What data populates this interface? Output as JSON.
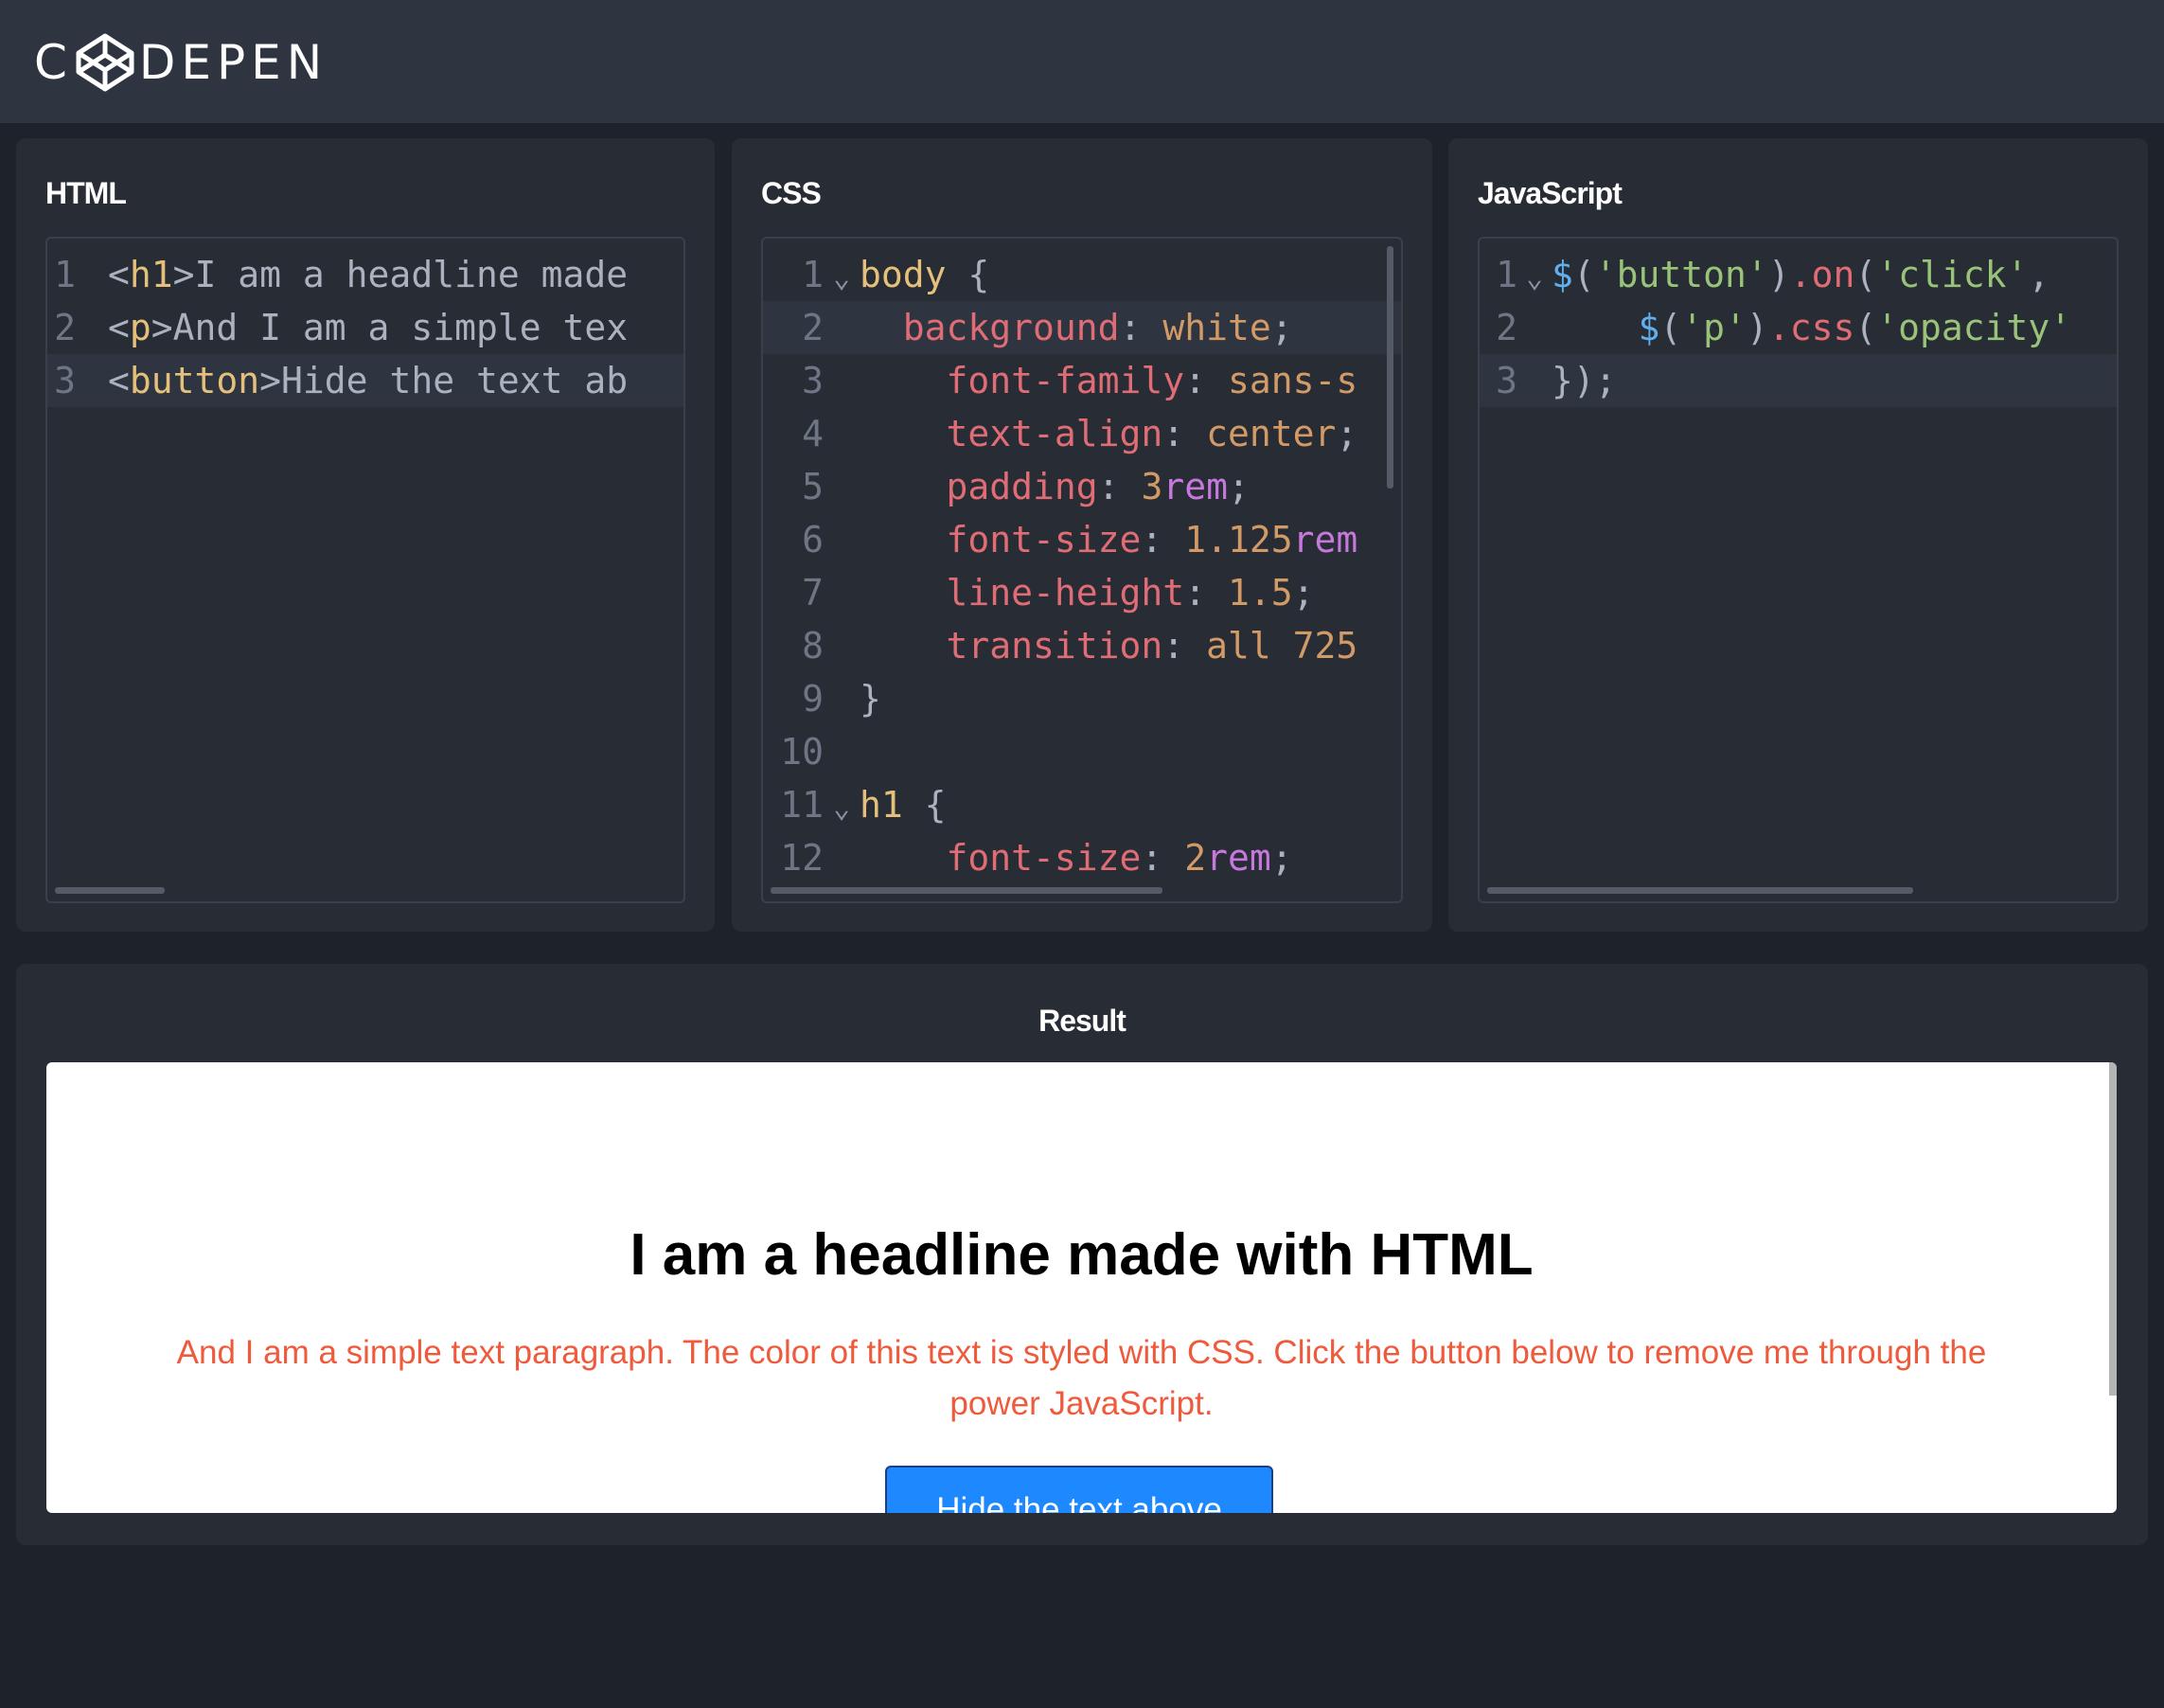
{
  "app": {
    "logo_text_left": "C",
    "logo_text_right": "DEPEN"
  },
  "panels": {
    "html": {
      "title": "HTML",
      "lines": [
        {
          "n": "1",
          "parts": [
            [
              "<",
              "c-pun"
            ],
            [
              "h1",
              "c-tag"
            ],
            [
              ">I am a headline made",
              "c-pun"
            ]
          ]
        },
        {
          "n": "2",
          "parts": [
            [
              "<",
              "c-pun"
            ],
            [
              "p",
              "c-tag"
            ],
            [
              ">And I am a simple tex",
              "c-pun"
            ]
          ]
        },
        {
          "n": "3",
          "parts": [
            [
              "<",
              "c-pun"
            ],
            [
              "button",
              "c-tag"
            ],
            [
              ">Hide the text ab",
              "c-pun"
            ]
          ]
        }
      ]
    },
    "css": {
      "title": "CSS",
      "lines": [
        {
          "n": "1",
          "fold": "⌄",
          "parts": [
            [
              "body",
              "c-sel"
            ],
            [
              " {",
              "c-pun"
            ]
          ]
        },
        {
          "n": "2",
          "parts": [
            [
              "  background",
              "c-prop"
            ],
            [
              ": ",
              "c-pun"
            ],
            [
              "white",
              "c-val"
            ],
            [
              ";",
              "c-pun"
            ]
          ]
        },
        {
          "n": "3",
          "parts": [
            [
              "    font-family",
              "c-prop"
            ],
            [
              ": ",
              "c-pun"
            ],
            [
              "sans-s",
              "c-val"
            ]
          ]
        },
        {
          "n": "4",
          "parts": [
            [
              "    text-align",
              "c-prop"
            ],
            [
              ": ",
              "c-pun"
            ],
            [
              "center",
              "c-val"
            ],
            [
              ";",
              "c-pun"
            ]
          ]
        },
        {
          "n": "5",
          "parts": [
            [
              "    padding",
              "c-prop"
            ],
            [
              ": ",
              "c-pun"
            ],
            [
              "3",
              "c-val"
            ],
            [
              "rem",
              "c-unit"
            ],
            [
              ";",
              "c-pun"
            ]
          ]
        },
        {
          "n": "6",
          "parts": [
            [
              "    font-size",
              "c-prop"
            ],
            [
              ": ",
              "c-pun"
            ],
            [
              "1.125",
              "c-val"
            ],
            [
              "rem",
              "c-unit"
            ]
          ]
        },
        {
          "n": "7",
          "parts": [
            [
              "    line-height",
              "c-prop"
            ],
            [
              ": ",
              "c-pun"
            ],
            [
              "1.5",
              "c-val"
            ],
            [
              ";",
              "c-pun"
            ]
          ]
        },
        {
          "n": "8",
          "parts": [
            [
              "    transition",
              "c-prop"
            ],
            [
              ": ",
              "c-pun"
            ],
            [
              "all 725",
              "c-val"
            ]
          ]
        },
        {
          "n": "9",
          "parts": [
            [
              "}",
              "c-pun"
            ]
          ]
        },
        {
          "n": "10",
          "parts": []
        },
        {
          "n": "11",
          "fold": "⌄",
          "parts": [
            [
              "h1",
              "c-sel"
            ],
            [
              " {",
              "c-pun"
            ]
          ]
        },
        {
          "n": "12",
          "parts": [
            [
              "    font-size",
              "c-prop"
            ],
            [
              ": ",
              "c-pun"
            ],
            [
              "2",
              "c-val"
            ],
            [
              "rem",
              "c-unit"
            ],
            [
              ";",
              "c-pun"
            ]
          ]
        }
      ]
    },
    "js": {
      "title": "JavaScript",
      "lines": [
        {
          "n": "1",
          "fold": "⌄",
          "parts": [
            [
              "$",
              "c-fn"
            ],
            [
              "(",
              "c-pun"
            ],
            [
              "'button'",
              "c-str"
            ],
            [
              ")",
              "c-pun"
            ],
            [
              ".on",
              "c-meth"
            ],
            [
              "(",
              "c-pun"
            ],
            [
              "'click'",
              "c-str"
            ],
            [
              ",",
              "c-pun"
            ]
          ]
        },
        {
          "n": "2",
          "parts": [
            [
              "    $",
              "c-fn"
            ],
            [
              "(",
              "c-pun"
            ],
            [
              "'p'",
              "c-str"
            ],
            [
              ")",
              "c-pun"
            ],
            [
              ".css",
              "c-meth"
            ],
            [
              "(",
              "c-pun"
            ],
            [
              "'opacity'",
              "c-str"
            ]
          ]
        },
        {
          "n": "3",
          "parts": [
            [
              "});",
              "c-pun"
            ]
          ]
        }
      ]
    }
  },
  "result": {
    "title": "Result",
    "headline": "I am a headline made with HTML",
    "paragraph": "And I am a simple text paragraph. The color of this text is styled with CSS. Click the button below to remove me through the power JavaScript.",
    "button_label": "Hide the text above"
  }
}
